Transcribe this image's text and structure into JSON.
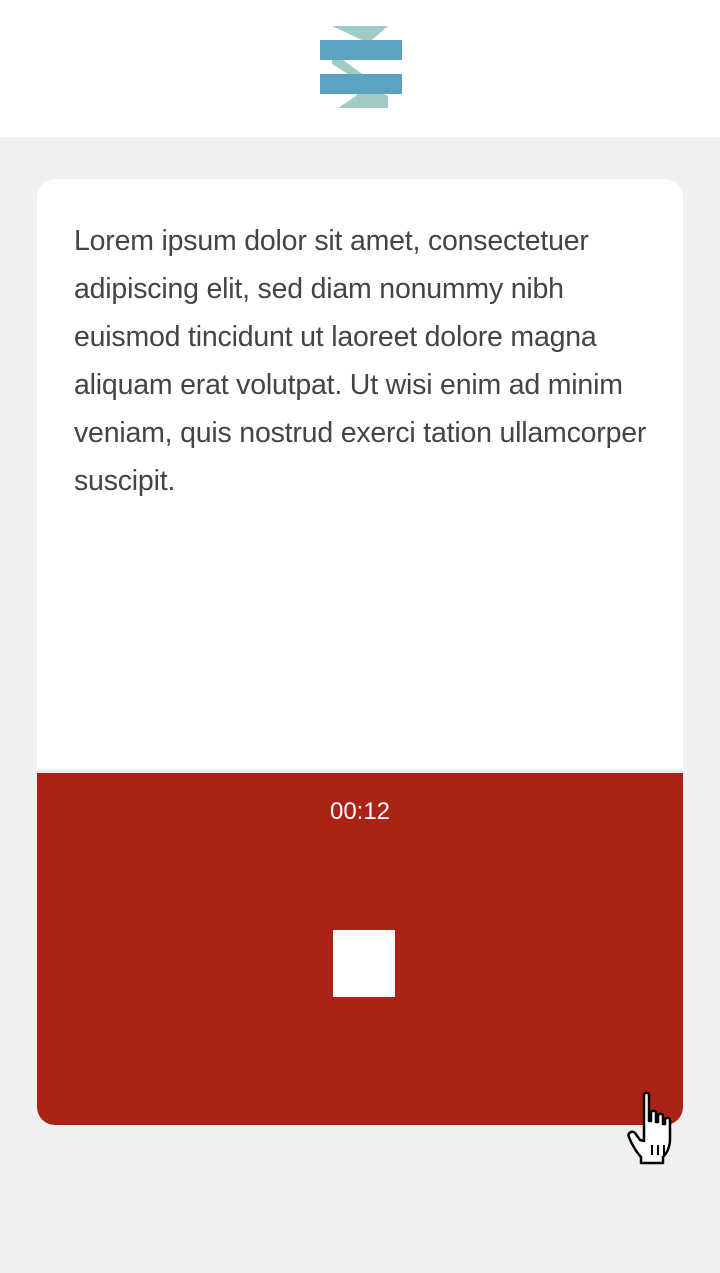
{
  "header": {
    "logo_icon": "stacked-bars-logo-icon",
    "colors": {
      "bar": "#5ba3c0",
      "diagonal": "#9fcbc6"
    }
  },
  "prompt": {
    "text": "Lorem ipsum dolor sit amet, consectetuer adipiscing elit, sed diam nonummy nibh euismod tincidunt ut laoreet dolore magna aliquam erat volutpat. Ut wisi enim ad minim veniam, quis nostrud exerci tation ullamcorper suscipit."
  },
  "recorder": {
    "timer": "00:12",
    "stop_icon": "stop-square-icon",
    "background_color": "#ab2316"
  },
  "cursor": {
    "icon": "hand-pointer-cursor-icon"
  }
}
